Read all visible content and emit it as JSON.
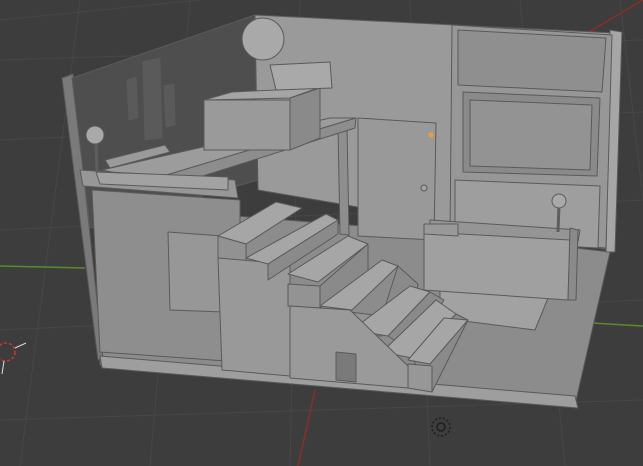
{
  "viewport": {
    "background": "#3d3d3d",
    "grid_color": "#474747",
    "x_axis_color": "#8a2d2d",
    "y_axis_color": "#5b8a2d",
    "selection_color": "#f59a36"
  },
  "scene": {
    "material": "#8f8f8f",
    "objects": [
      "floor",
      "back-wall",
      "left-wall",
      "loft-bed",
      "staircase",
      "door",
      "tv-cabinet",
      "sofa",
      "rug",
      "lamp-left",
      "lamp-right",
      "ceiling-light"
    ]
  },
  "gizmos": {
    "camera_icon": "camera-icon",
    "light_icon": "light-icon"
  }
}
